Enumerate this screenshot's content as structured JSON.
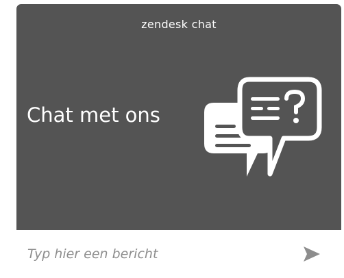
{
  "widget": {
    "brand": "zendesk chat",
    "headline": "Chat met ons",
    "illustration_icon": "chat-bubbles-question-icon",
    "panel_color": "#545454"
  },
  "composer": {
    "placeholder": "Typ hier een bericht",
    "value": "",
    "send_icon": "send-arrow-icon",
    "send_icon_color": "#8d8d8d"
  }
}
